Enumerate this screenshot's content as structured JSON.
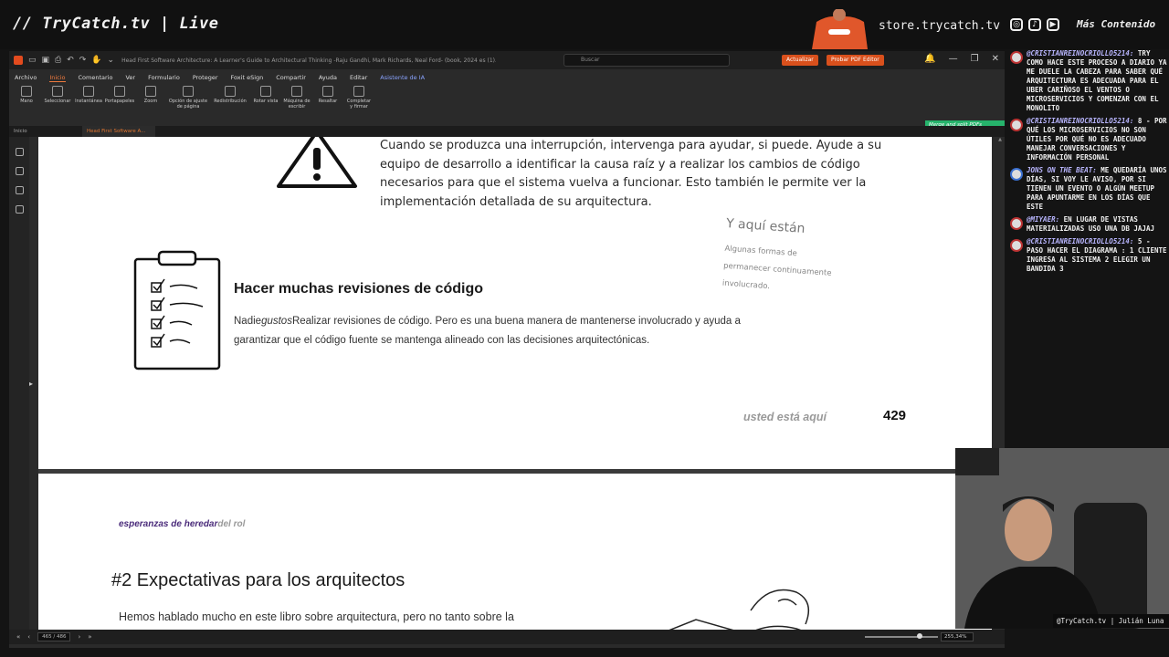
{
  "overlay": {
    "brand": "// TryCatch.tv | Live",
    "store": "store.trycatch.tv",
    "more": "Más Contenido",
    "cam_caption": "@TryCatch.tv | Julián Luna",
    "social_icons": [
      "instagram-icon",
      "tiktok-icon",
      "youtube-icon"
    ]
  },
  "app": {
    "doc_title": "Head First Software Architecture: A Learner's Guide to Architectural Thinking -Raju Gandhi, Mark Richards, Neal Ford- (book, 2024 es (1).pdf",
    "search_placeholder": "Buscar",
    "update_label": "Actualizar",
    "trial_label": "Probar PDF Editor",
    "menu": [
      "Archivo",
      "Inicio",
      "Comentario",
      "Ver",
      "Formulario",
      "Proteger",
      "Foxit eSign",
      "Compartir",
      "Ayuda",
      "Editar",
      "Asistente de IA"
    ],
    "ribbon": [
      "Mano",
      "Seleccionar",
      "Instantánea",
      "Portapapeles",
      "Zoom",
      "Opción de ajuste de página",
      "Redistribución",
      "Rotar vista",
      "Máquina de escribir",
      "Resaltar",
      "Completar y firmar"
    ],
    "tabs": [
      "Inicio",
      "Head First Software A..."
    ],
    "merge_banner": "Merge and split PDFs",
    "page_box": "465 / 486",
    "zoom": "255,34%"
  },
  "page1": {
    "para": "Cuando se produzca una interrupción, intervenga para ayudar, si puede. Ayude a su equipo de desarrollo a identificar la causa raíz y a realizar los cambios de código necesarios para que el sistema vuelva a funcionar. Esto también le permite ver la implementación detallada de su arquitectura.",
    "hand_note_title": "Y aquí están",
    "hand_note_body": "Algunas formas de permanecer continuamente involucrado.",
    "heading": "Hacer muchas revisiones de código",
    "body_prefix": "Nadie",
    "body_italic": "gustos",
    "body_rest": "Realizar revisiones de código. Pero es una buena manera de mantenerse involucrado y ayuda a garantizar que el código fuente se mantenga alineado con las decisiones arquitectónicas.",
    "footer_here": "usted está aquí",
    "page_number": "429"
  },
  "page2": {
    "running_a": "esperanzas de heredar",
    "running_b": "del rol",
    "heading": "#2 Expectativas para los arquitectos",
    "para": "Hemos hablado mucho en este libro sobre arquitectura, pero no tanto sobre la"
  },
  "chat": [
    {
      "user": "@CristianReinoCriollo5214:",
      "text": "TRY COMO HACE ESTE PROCESO A DIARIO YA ME DUELE LA CABEZA PARA SABER QUÉ ARQUITECTURA ES ADECUADA PARA EL UBER CARIÑOSO EL VENTOS O MICROSERVICIOS Y COMENZAR CON EL MONOLITO",
      "badge": "red"
    },
    {
      "user": "@CristianReinoCriollo5214:",
      "text": "8 - POR QUÉ LOS MICROSERVICIOS NO SON ÚTILES POR QUÉ NO ES ADECUADO MANEJAR CONVERSACIONES Y INFORMACIÓN PERSONAL",
      "badge": "red"
    },
    {
      "user": "JONS ON THE BEAT:",
      "text": "ME QUEDARÍA UNOS DÍAS, SI VOY LE AVISO, POR SI TIENEN UN EVENTO O ALGÚN MEETUP PARA APUNTARME EN LOS DÍAS QUE ESTE",
      "badge": "blue"
    },
    {
      "user": "@miyaer:",
      "text": "EN LUGAR DE VISTAS MATERIALIZADAS USO UNA DB JAJAJ",
      "badge": "red"
    },
    {
      "user": "@CristianReinoCriollo5214:",
      "text": "5 - PASO HACER EL DIAGRAMA : 1 CLIENTE INGRESA AL SISTEMA 2 ELEGIR UN BANDIDA 3",
      "badge": "red"
    }
  ]
}
